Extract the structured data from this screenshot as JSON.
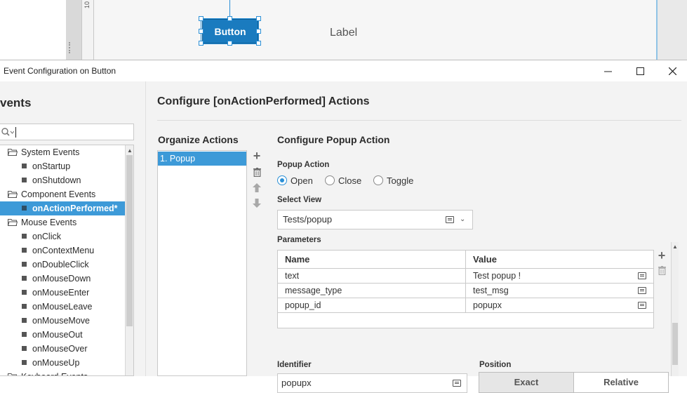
{
  "designer": {
    "ruler_label": "10",
    "button_text": "Button",
    "label_text": "Label"
  },
  "dialog": {
    "title": "Event Configuration on Button",
    "window_controls": [
      "minimize-icon",
      "maximize-icon",
      "close-icon"
    ]
  },
  "events_pane": {
    "heading": "vents",
    "search": {
      "value": "",
      "icon": "search-icon"
    },
    "tree": [
      {
        "type": "folder",
        "label": "System Events"
      },
      {
        "type": "leaf",
        "label": "onStartup"
      },
      {
        "type": "leaf",
        "label": "onShutdown"
      },
      {
        "type": "folder",
        "label": "Component Events"
      },
      {
        "type": "leaf",
        "label": "onActionPerformed*",
        "selected": true
      },
      {
        "type": "folder",
        "label": "Mouse Events"
      },
      {
        "type": "leaf",
        "label": "onClick"
      },
      {
        "type": "leaf",
        "label": "onContextMenu"
      },
      {
        "type": "leaf",
        "label": "onDoubleClick"
      },
      {
        "type": "leaf",
        "label": "onMouseDown"
      },
      {
        "type": "leaf",
        "label": "onMouseEnter"
      },
      {
        "type": "leaf",
        "label": "onMouseLeave"
      },
      {
        "type": "leaf",
        "label": "onMouseMove"
      },
      {
        "type": "leaf",
        "label": "onMouseOut"
      },
      {
        "type": "leaf",
        "label": "onMouseOver"
      },
      {
        "type": "leaf",
        "label": "onMouseUp"
      },
      {
        "type": "folder",
        "label": "Keyboard Events"
      }
    ]
  },
  "content": {
    "title": "Configure [onActionPerformed] Actions",
    "organize": {
      "heading": "Organize Actions",
      "items": [
        "1. Popup"
      ],
      "icons": [
        "add-icon",
        "delete-icon",
        "move-up-icon",
        "move-down-icon"
      ]
    },
    "popup": {
      "heading": "Configure Popup Action",
      "popup_action_label": "Popup Action",
      "radios": [
        {
          "label": "Open",
          "checked": true
        },
        {
          "label": "Close",
          "checked": false
        },
        {
          "label": "Toggle",
          "checked": false
        }
      ],
      "select_view_label": "Select View",
      "select_view_value": "Tests/popup",
      "parameters_label": "Parameters",
      "parameters_columns": [
        "Name",
        "Value"
      ],
      "parameters": [
        {
          "name": "text",
          "value": "Test popup !"
        },
        {
          "name": "message_type",
          "value": "test_msg"
        },
        {
          "name": "popup_id",
          "value": "popupx"
        }
      ],
      "identifier_label": "Identifier",
      "identifier_value": "popupx",
      "position_label": "Position",
      "position_options": [
        "Exact",
        "Relative"
      ],
      "position_selected": "Exact"
    }
  },
  "colors": {
    "accent": "#3d9ad8",
    "button_blue": "#1a7bbf",
    "panel_bg": "#f3f3f3"
  }
}
